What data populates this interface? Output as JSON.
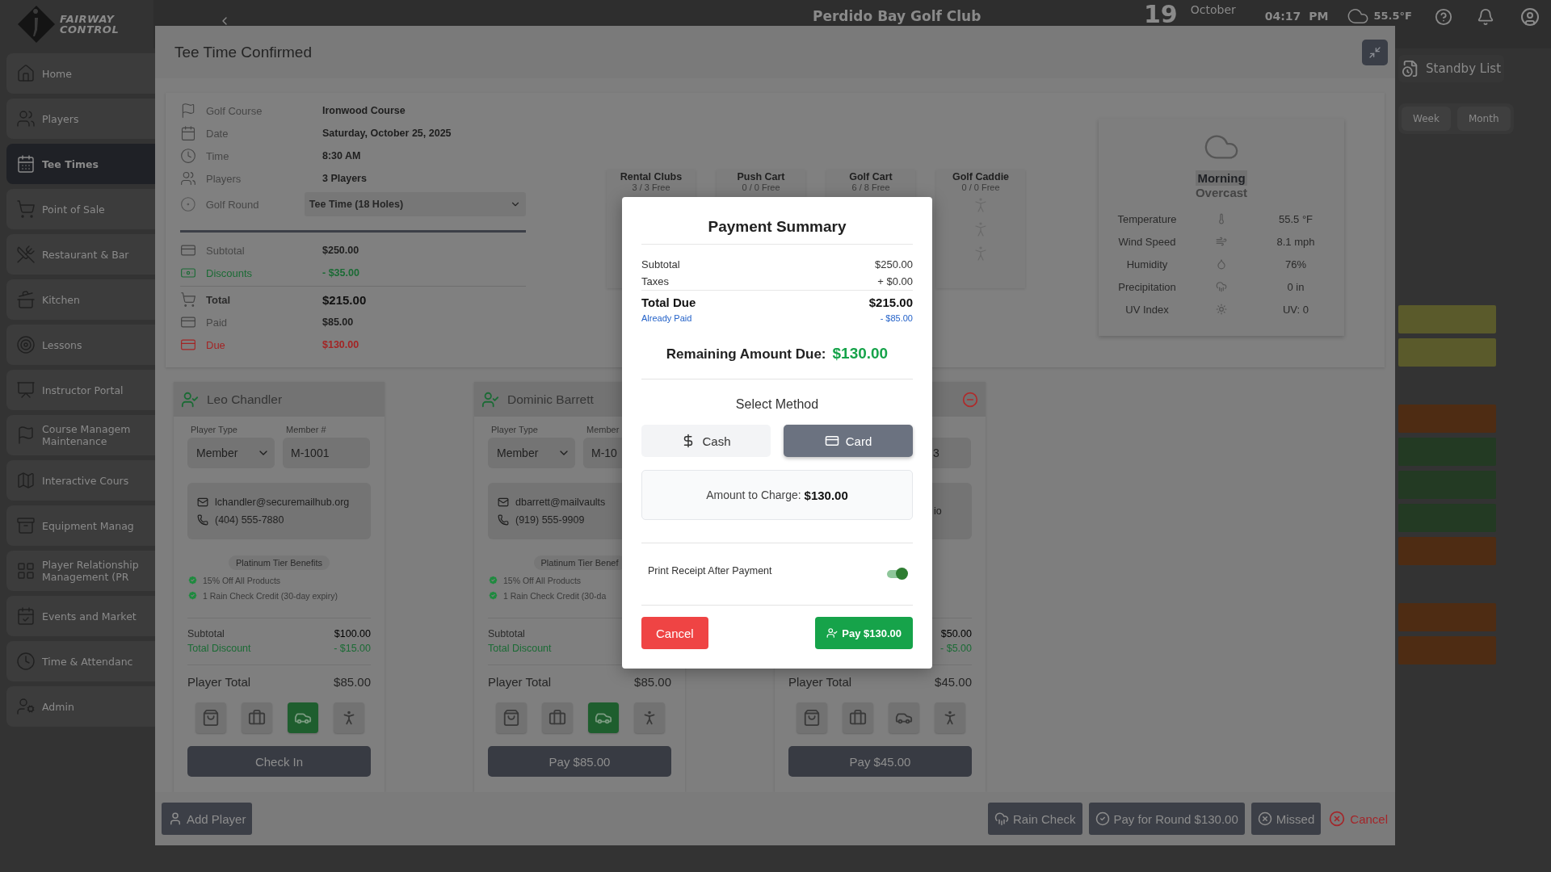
{
  "header": {
    "brand_lines": [
      "FAIRWAY",
      "CONTROL"
    ],
    "club": "Perdido Bay Golf Club",
    "day": "19",
    "month": "October",
    "time": "04:17",
    "meridiem": "PM",
    "temperature": "55.5°F"
  },
  "sidebar": {
    "items": [
      {
        "label": "Home",
        "selected": false
      },
      {
        "label": "Players",
        "selected": false
      },
      {
        "label": "Tee Times",
        "selected": true
      },
      {
        "label": "Point of Sale",
        "selected": false
      },
      {
        "label": "Restaurant & Bar",
        "selected": false
      },
      {
        "label": "Kitchen",
        "selected": false
      },
      {
        "label": "Lessons",
        "selected": false
      },
      {
        "label": "Instructor Portal",
        "selected": false
      },
      {
        "label": "Course Managem\nMaintenance",
        "selected": false
      },
      {
        "label": "Interactive Cours",
        "selected": false
      },
      {
        "label": "Equipment Manag",
        "selected": false
      },
      {
        "label": "Player Relationship\nManagement (PR",
        "selected": false
      },
      {
        "label": "Events and Market",
        "selected": false
      },
      {
        "label": "Time & Attendanc",
        "selected": false
      },
      {
        "label": "Admin",
        "selected": false
      }
    ]
  },
  "standby": {
    "label": "Standby List",
    "views": [
      {
        "label": "Week",
        "selected": false
      },
      {
        "label": "Month",
        "selected": false
      }
    ],
    "blocks": [
      {
        "kind": "event",
        "color": "#5a5a2b"
      },
      {
        "kind": "event",
        "color": "#5a5a2b"
      },
      {
        "kind": "empty"
      },
      {
        "kind": "event",
        "color": "#4e2c13"
      },
      {
        "kind": "event",
        "color": "#233a23"
      },
      {
        "kind": "event",
        "color": "#233a23"
      },
      {
        "kind": "event",
        "color": "#233a23"
      },
      {
        "kind": "event",
        "color": "#4e2c13"
      },
      {
        "kind": "empty"
      },
      {
        "kind": "event",
        "color": "#4e2c13"
      },
      {
        "kind": "event",
        "color": "#4e2c13"
      }
    ]
  },
  "tee_time": {
    "title": "Tee Time Confirmed",
    "details": [
      {
        "label": "Golf Course",
        "value": "Ironwood Course"
      },
      {
        "label": "Date",
        "value": "Saturday, October 25, 2025"
      },
      {
        "label": "Time",
        "value": "8:30 AM"
      },
      {
        "label": "Players",
        "value": "3 Players"
      }
    ],
    "round": {
      "label": "Golf Round",
      "value": "Tee Time (18 Holes)"
    },
    "summary": [
      {
        "kind": "plain",
        "label": "Subtotal",
        "value": "$250.00"
      },
      {
        "kind": "discount",
        "label": "Discounts",
        "value": "- $35.00"
      },
      {
        "kind": "total",
        "label": "Total",
        "value": "$215.00"
      },
      {
        "kind": "plain",
        "label": "Paid",
        "value": "$85.00"
      },
      {
        "kind": "due",
        "label": "Due",
        "value": "$130.00"
      }
    ],
    "equipment": [
      {
        "name": "Rental Clubs",
        "availability": "3 / 3 Free"
      },
      {
        "name": "Push Cart",
        "availability": "0 / 0 Free"
      },
      {
        "name": "Golf Cart",
        "availability": "6 / 8 Free"
      },
      {
        "name": "Golf Caddie",
        "availability": "0 / 0 Free"
      }
    ],
    "weather": {
      "period": "Morning",
      "condition": "Overcast",
      "rows": [
        {
          "label": "Temperature",
          "value": "55.5 °F"
        },
        {
          "label": "Wind Speed",
          "value": "8.1 mph"
        },
        {
          "label": "Humidity",
          "value": "76%"
        },
        {
          "label": "Precipitation",
          "value": "0 in"
        },
        {
          "label": "UV Index",
          "value": "UV: 0"
        }
      ]
    },
    "players": [
      {
        "name": "Leo Chandler",
        "removable": false,
        "type_label": "Player Type",
        "type": "Member",
        "member_label": "Member #",
        "member": "M-1001",
        "email": "lchandler@securemailhub.org",
        "phone": "(404) 555-7880",
        "tier": "Platinum Tier Benefits",
        "benefits": [
          "15% Off All Products",
          "1 Rain Check Credit (30-day expiry)"
        ],
        "subtotal_label": "Subtotal",
        "subtotal": "$100.00",
        "discount_label": "Total Discount",
        "discount": "- $15.00",
        "total_label": "Player Total",
        "total": "$85.00",
        "equipment": [
          {
            "selected": false
          },
          {
            "selected": false
          },
          {
            "selected": true
          },
          {
            "selected": false
          }
        ],
        "action": "Check In"
      },
      {
        "name": "Dominic Barrett",
        "removable": false,
        "type_label": "Player Type",
        "type": "Member",
        "member_label": "Member",
        "member": "M-10",
        "email": "dbarrett@mailvaults",
        "phone": "(919) 555-9909",
        "tier": "Platinum Tier Benef",
        "benefits": [
          "15% Off All Products",
          "1 Rain Check Credit (30-da"
        ],
        "subtotal_label": "Subtotal",
        "discount_label": "Total Discount",
        "total_label": "Player Total",
        "total": "$85.00",
        "equipment": [
          {
            "selected": false
          },
          {
            "selected": false
          },
          {
            "selected": true
          },
          {
            "selected": false
          }
        ],
        "action": "Pay $85.00"
      },
      {
        "removable": true,
        "member": "3",
        "email": "io",
        "subtotal": "$50.00",
        "discount": "- $5.00",
        "total_label": "Player Total",
        "total": "$45.00",
        "equipment": [
          {
            "selected": false
          },
          {
            "selected": false
          },
          {
            "selected": false
          },
          {
            "selected": false
          }
        ],
        "action": "Pay $45.00"
      }
    ],
    "actions": {
      "add": "Add Player",
      "rain_check": "Rain Check",
      "pay_round": "Pay for Round $130.00",
      "missed": "Missed",
      "cancel": "Cancel"
    }
  },
  "payment": {
    "title": "Payment Summary",
    "rows": [
      {
        "kind": "plain",
        "label": "Subtotal",
        "value": "$250.00"
      },
      {
        "kind": "plain",
        "label": "Taxes",
        "value": "+ $0.00"
      },
      {
        "kind": "total",
        "label": "Total Due",
        "value": "$215.00"
      },
      {
        "kind": "paid",
        "label": "Already Paid",
        "value": "- $85.00"
      }
    ],
    "remaining_label": "Remaining Amount Due:",
    "remaining_value": "$130.00",
    "method_title": "Select Method",
    "methods": [
      {
        "label": "Cash",
        "selected": false
      },
      {
        "label": "Card",
        "selected": true
      }
    ],
    "charge_label": "Amount to Charge:",
    "charge_value": "$130.00",
    "receipt": {
      "label": "Print Receipt After Payment",
      "on": true
    },
    "cancel": "Cancel",
    "pay": "Pay $130.00"
  }
}
